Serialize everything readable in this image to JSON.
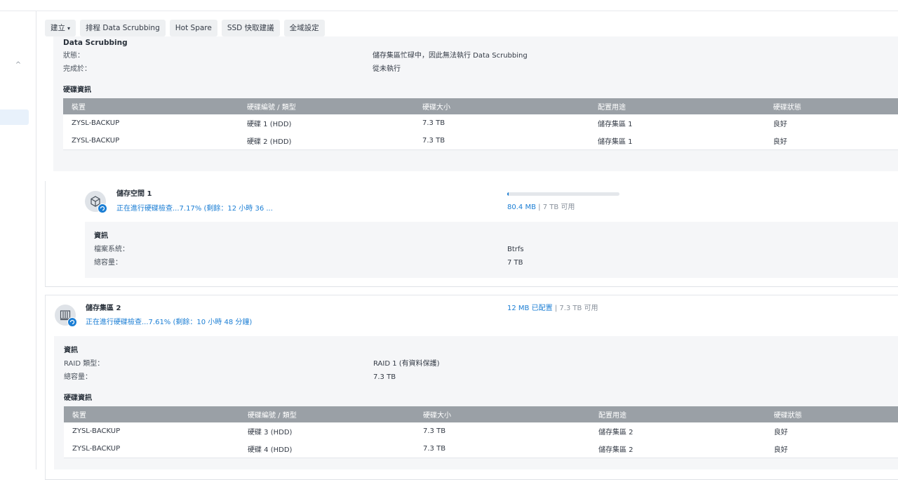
{
  "toolbar": {
    "create": "建立",
    "schedule_scrubbing": "排程 Data Scrubbing",
    "hot_spare": "Hot Spare",
    "ssd_cache": "SSD 快取建議",
    "global_settings": "全域設定"
  },
  "pool1": {
    "scrub_title": "Data Scrubbing",
    "status_label": "狀態：",
    "status_value": "儲存集區忙碌中，因此無法執行 Data Scrubbing",
    "completed_label": "完成於：",
    "completed_value": "從未執行",
    "disk_info_title": "硬碟資訊",
    "table": {
      "headers": [
        "裝置",
        "硬碟編號 / 類型",
        "硬碟大小",
        "配置用途",
        "硬碟狀態"
      ],
      "rows": [
        [
          "ZYSL-BACKUP",
          "硬碟 1 (HDD)",
          "7.3 TB",
          "儲存集區 1",
          "良好"
        ],
        [
          "ZYSL-BACKUP",
          "硬碟 2 (HDD)",
          "7.3 TB",
          "儲存集區 1",
          "良好"
        ]
      ]
    }
  },
  "volume1": {
    "icon": "volume-cube-icon",
    "name": "儲存空間 1",
    "progress_text": "正在進行硬碟檢查...7.17% (剩餘：12 小時 36 ...",
    "used": "80.4 MB",
    "separator": "|",
    "available": "7 TB 可用",
    "usage_fraction": 0.01,
    "info_title": "資訊",
    "fs_label": "檔案系統：",
    "fs_value": "Btrfs",
    "capacity_label": "總容量：",
    "capacity_value": "7 TB"
  },
  "pool2": {
    "icon": "storage-pool-icon",
    "name": "儲存集區 2",
    "progress_text": "正在進行硬碟檢查...7.61% (剩餘：10 小時 48 分鐘)",
    "allocated": "12 MB 已配置",
    "separator": "|",
    "available": "7.3 TB 可用",
    "info_title": "資訊",
    "raid_label": "RAID 類型：",
    "raid_value": "RAID 1 (有資料保護)",
    "capacity_label": "總容量：",
    "capacity_value": "7.3 TB",
    "disk_info_title": "硬碟資訊",
    "table": {
      "headers": [
        "裝置",
        "硬碟編號 / 類型",
        "硬碟大小",
        "配置用途",
        "硬碟狀態"
      ],
      "rows": [
        [
          "ZYSL-BACKUP",
          "硬碟 3 (HDD)",
          "7.3 TB",
          "儲存集區 2",
          "良好"
        ],
        [
          "ZYSL-BACKUP",
          "硬碟 4 (HDD)",
          "7.3 TB",
          "儲存集區 2",
          "良好"
        ]
      ]
    }
  },
  "colors": {
    "accent": "#1b7ed4",
    "healthy": "#3aa33a",
    "table_header": "#9aa0a6"
  }
}
